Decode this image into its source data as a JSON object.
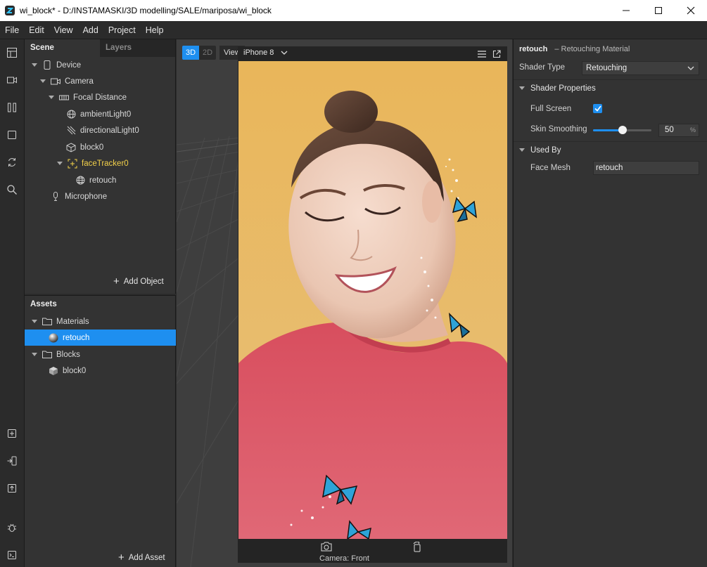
{
  "window": {
    "title": "wi_block* - D:/INSTAMASKI/3D modelling/SALE/mariposa/wi_block"
  },
  "menu": [
    "File",
    "Edit",
    "View",
    "Add",
    "Project",
    "Help"
  ],
  "scene": {
    "tabs": [
      "Scene",
      "Layers"
    ],
    "tree": [
      {
        "label": "Device",
        "icon": "phone-icon"
      },
      {
        "label": "Camera",
        "icon": "camera-icon"
      },
      {
        "label": "Focal Distance",
        "icon": "focal-distance-icon"
      },
      {
        "label": "ambientLight0",
        "icon": "globe-light-icon"
      },
      {
        "label": "directionalLight0",
        "icon": "directional-light-icon"
      },
      {
        "label": "block0",
        "icon": "cube-outline-icon"
      },
      {
        "label": "faceTracker0",
        "icon": "face-tracker-icon"
      },
      {
        "label": "retouch",
        "icon": "mesh-icon"
      },
      {
        "label": "Microphone",
        "icon": "microphone-icon"
      }
    ],
    "add_object_label": "Add Object"
  },
  "assets": {
    "title": "Assets",
    "tree": [
      {
        "label": "Materials",
        "icon": "folder-icon"
      },
      {
        "label": "retouch",
        "icon": "material-sphere-icon",
        "selected": true
      },
      {
        "label": "Blocks",
        "icon": "folder-icon"
      },
      {
        "label": "block0",
        "icon": "block-cube-icon"
      }
    ],
    "add_asset_label": "Add Asset"
  },
  "viewport": {
    "mode_3d": "3D",
    "mode_2d": "2D",
    "view_label": "View",
    "device_name": "iPhone 8",
    "camera_label": "Camera: Front"
  },
  "inspector": {
    "name": "retouch",
    "subtitle": "– Retouching Material",
    "shader_type_label": "Shader Type",
    "shader_type_value": "Retouching",
    "shader_properties_label": "Shader Properties",
    "full_screen_label": "Full Screen",
    "full_screen_checked": true,
    "skin_smoothing_label": "Skin Smoothing",
    "skin_smoothing_value": "50",
    "skin_smoothing_unit": "%",
    "used_by_label": "Used By",
    "face_mesh_label": "Face Mesh",
    "face_mesh_value": "retouch"
  },
  "colors": {
    "accent": "#1e8ff0",
    "panel": "#333333",
    "highlight_text": "#f2d04a"
  }
}
